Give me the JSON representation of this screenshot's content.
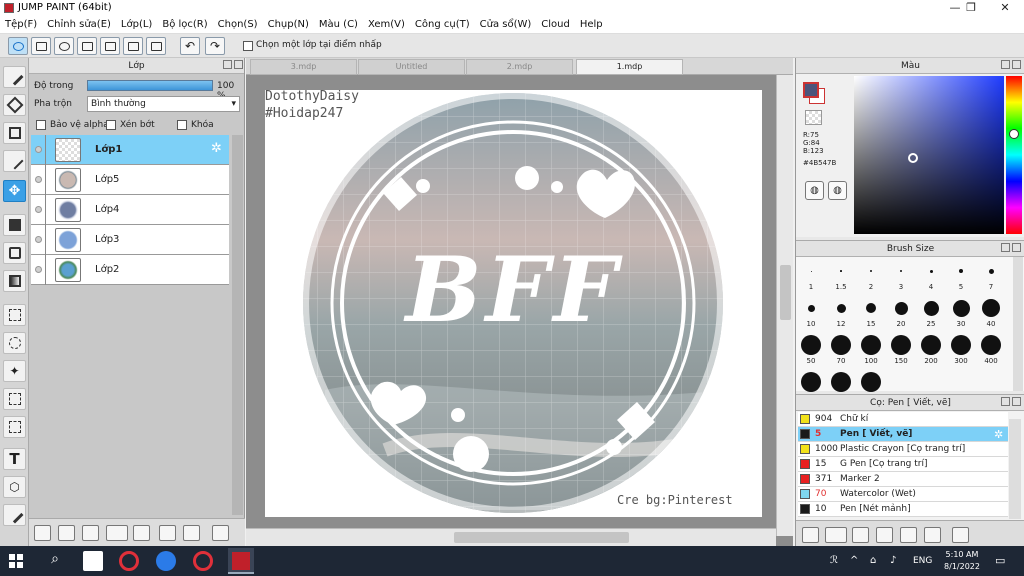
{
  "window": {
    "title": "JUMP PAINT (64bit)"
  },
  "menu": [
    "Tệp(F)",
    "Chỉnh sửa(E)",
    "Lớp(L)",
    "Bộ lọc(R)",
    "Chọn(S)",
    "Chụp(N)",
    "Màu (C)",
    "Xem(V)",
    "Công cụ(T)",
    "Cửa sổ(W)",
    "Cloud",
    "Help"
  ],
  "toolbar": {
    "option_label": "Chọn một lớp tại điểm nhấp"
  },
  "layer_panel": {
    "title": "Lớp",
    "opacity_label": "Độ trong",
    "opacity_value": "100 %",
    "blend_label": "Pha trộn",
    "blend_value": "Bình thường",
    "protect_alpha": "Bảo vệ alpha",
    "clip": "Xén bớt",
    "lock": "Khóa",
    "layers": [
      {
        "name": "Lớp1",
        "selected": true
      },
      {
        "name": "Lớp5",
        "selected": false
      },
      {
        "name": "Lớp4",
        "selected": false
      },
      {
        "name": "Lớp3",
        "selected": false
      },
      {
        "name": "Lớp2",
        "selected": false
      }
    ]
  },
  "tabs": [
    {
      "label": "3.mdp",
      "active": false
    },
    {
      "label": "Untitled",
      "active": false
    },
    {
      "label": "2.mdp",
      "active": false
    },
    {
      "label": "1.mdp",
      "active": true
    }
  ],
  "canvas": {
    "author": "DotothyDaisy",
    "hashtag": "#Hoidap247",
    "main_text": "BFF",
    "credit": "Cre bg:Pinterest"
  },
  "color_panel": {
    "title": "Màu",
    "r": "R:75",
    "g": "G:84",
    "b": "B:123",
    "hex": "#4B547B",
    "current_color": "#4B547B"
  },
  "brush_panel": {
    "title": "Brush Size",
    "sizes": [
      "1",
      "1.5",
      "2",
      "3",
      "4",
      "5",
      "7",
      "10",
      "12",
      "15",
      "20",
      "25",
      "30",
      "40",
      "50",
      "70",
      "100",
      "150",
      "200",
      "300",
      "400"
    ]
  },
  "pen_panel": {
    "title": "Cọ: Pen [ Viết, vẽ]",
    "items": [
      {
        "num": "904",
        "name": "Chữ kí",
        "color": "#f2e21a",
        "selected": false
      },
      {
        "num": "5",
        "name": "Pen [ Viết, vẽ]",
        "color": "#1a1a1a",
        "selected": true
      },
      {
        "num": "1000",
        "name": "Plastic Crayon [Cọ trang trí]",
        "color": "#f2e21a",
        "selected": false
      },
      {
        "num": "15",
        "name": "G Pen [Cọ trang trí]",
        "color": "#e82020",
        "selected": false
      },
      {
        "num": "371",
        "name": "Marker 2",
        "color": "#e82020",
        "selected": false
      },
      {
        "num": "70",
        "name": "Watercolor (Wet)",
        "color": "#7fd6ee",
        "selected": false
      },
      {
        "num": "10",
        "name": "Pen [Nét mảnh]",
        "color": "#1a1a1a",
        "selected": false
      }
    ]
  },
  "taskbar": {
    "time": "5:10 AM",
    "date": "8/1/2022",
    "lang": "ENG"
  }
}
